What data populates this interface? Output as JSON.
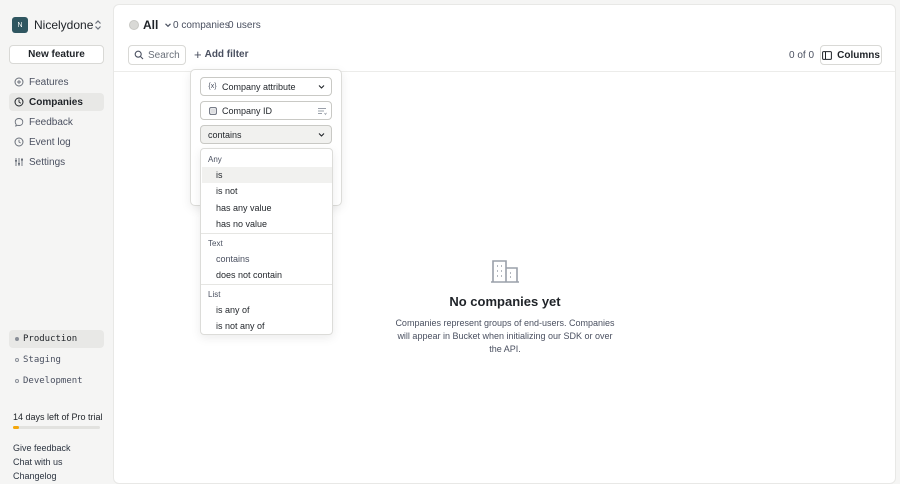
{
  "sidebar": {
    "org_initial": "N",
    "org_name": "Nicelydone",
    "new_feature": "New feature",
    "nav": [
      {
        "label": "Features",
        "icon": "features-icon"
      },
      {
        "label": "Companies",
        "icon": "companies-icon"
      },
      {
        "label": "Feedback",
        "icon": "feedback-icon"
      },
      {
        "label": "Event log",
        "icon": "event-log-icon"
      },
      {
        "label": "Settings",
        "icon": "settings-icon"
      }
    ],
    "environments": [
      "Production",
      "Staging",
      "Development"
    ],
    "active_environment": "Production",
    "trial_text": "14 days left of Pro trial",
    "trial_progress": 0.07,
    "footer_links": [
      "Give feedback",
      "Chat with us",
      "Changelog"
    ]
  },
  "topbar": {
    "scope": "All",
    "companies_count": "0 companies",
    "users_count": "0 users"
  },
  "toolbar": {
    "search_placeholder": "Search",
    "add_filter": "Add filter",
    "pager": "0 of 0",
    "columns": "Columns"
  },
  "filter_popover": {
    "attribute_type": "Company attribute",
    "attribute": "Company ID",
    "operator": "contains"
  },
  "operator_dropdown": {
    "groups": [
      {
        "label": "Any",
        "options": [
          "is",
          "is not",
          "has any value",
          "has no value"
        ]
      },
      {
        "label": "Text",
        "options": [
          "contains",
          "does not contain"
        ]
      },
      {
        "label": "List",
        "options": [
          "is any of",
          "is not any of"
        ]
      }
    ],
    "highlighted": "is",
    "selected": "contains"
  },
  "empty_state": {
    "title": "No companies yet",
    "description": "Companies represent groups of end-users. Companies will appear in Bucket when initializing our SDK or over the API."
  },
  "colors": {
    "accent_trial": "#f5a70a",
    "org_avatar": "#2f5660"
  }
}
